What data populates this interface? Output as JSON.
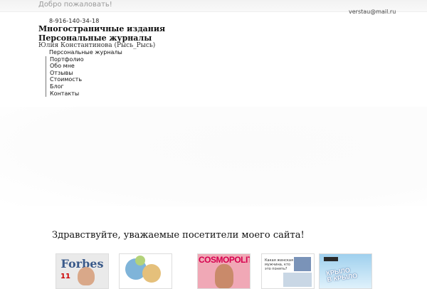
{
  "header": {
    "welcome": "Добро пожаловать!",
    "email": "verstau@mail.ru",
    "phone": "8-916-140-34-18",
    "title_line1": "Многостраничные издания",
    "title_line2": "Персональные журналы",
    "owner": "Юлия Константинова (Рысь_Рысь)"
  },
  "menu": {
    "items": [
      {
        "label": "Персональные журналы"
      },
      {
        "label": "Портфолио"
      },
      {
        "label": "Обо мне"
      },
      {
        "label": "Отзывы"
      },
      {
        "label": "Стоимость"
      },
      {
        "label": "Блог"
      },
      {
        "label": "Контакты"
      }
    ]
  },
  "main": {
    "greeting": "Здравствуйте, уважаемые посетители моего сайта!",
    "thumbs": [
      {
        "mast": "Forbes",
        "num": "11"
      },
      {
        "mast": ""
      },
      {
        "mast": "COSMOPOLITAN"
      },
      {
        "headline": "Какая женская мужчина, кто это понять?"
      },
      {
        "mast_line1": "КРЫЛО",
        "mast_line2": "В КРЫЛО"
      }
    ]
  }
}
